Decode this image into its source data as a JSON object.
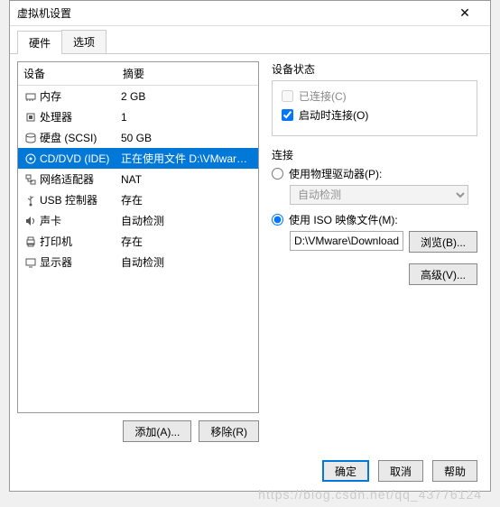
{
  "window": {
    "title": "虚拟机设置",
    "close": "✕"
  },
  "tabs": {
    "hardware": "硬件",
    "options": "选项"
  },
  "headers": {
    "device": "设备",
    "summary": "摘要"
  },
  "devices": [
    {
      "id": "memory",
      "name": "内存",
      "summary": "2 GB",
      "icon": "memory-icon"
    },
    {
      "id": "cpu",
      "name": "处理器",
      "summary": "1",
      "icon": "cpu-icon"
    },
    {
      "id": "hdd",
      "name": "硬盘 (SCSI)",
      "summary": "50 GB",
      "icon": "disk-icon"
    },
    {
      "id": "cd",
      "name": "CD/DVD (IDE)",
      "summary": "正在使用文件 D:\\VMware\\Dow...",
      "icon": "cd-icon",
      "selected": true
    },
    {
      "id": "net",
      "name": "网络适配器",
      "summary": "NAT",
      "icon": "network-icon"
    },
    {
      "id": "usb",
      "name": "USB 控制器",
      "summary": "存在",
      "icon": "usb-icon"
    },
    {
      "id": "sound",
      "name": "声卡",
      "summary": "自动检测",
      "icon": "sound-icon"
    },
    {
      "id": "printer",
      "name": "打印机",
      "summary": "存在",
      "icon": "printer-icon"
    },
    {
      "id": "display",
      "name": "显示器",
      "summary": "自动检测",
      "icon": "display-icon"
    }
  ],
  "buttons": {
    "add": "添加(A)...",
    "remove": "移除(R)",
    "browse": "浏览(B)...",
    "advanced": "高级(V)...",
    "ok": "确定",
    "cancel": "取消",
    "help": "帮助"
  },
  "status": {
    "group": "设备状态",
    "connected": "已连接(C)",
    "connect_at_power": "启动时连接(O)"
  },
  "connection": {
    "group": "连接",
    "use_physical": "使用物理驱动器(P):",
    "auto_detect": "自动检测",
    "use_iso": "使用 ISO 映像文件(M):",
    "iso_path": "D:\\VMware\\Downloads\\kali-"
  },
  "watermark": "https://blog.csdn.net/qq_43776124"
}
